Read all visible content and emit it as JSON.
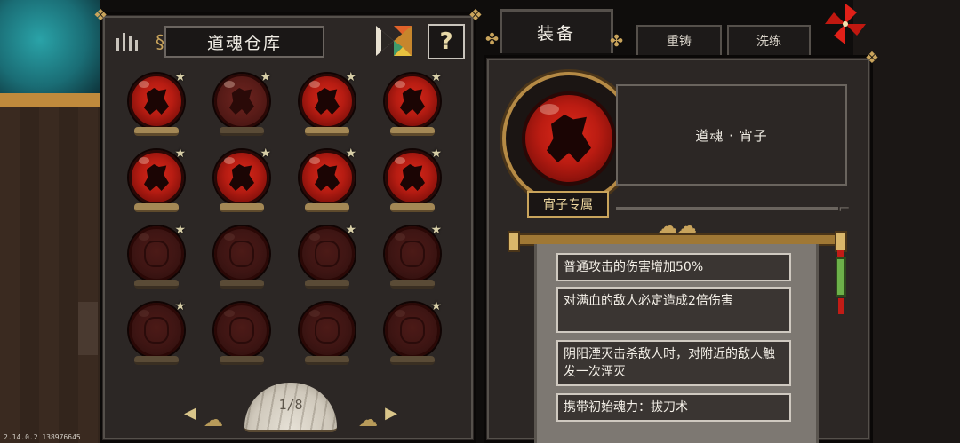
{
  "storage": {
    "title": "道魂仓库",
    "help_label": "?",
    "pager": {
      "current": 1,
      "total": 8,
      "label": "1/8",
      "prev_label": "◀",
      "next_label": "▶"
    },
    "slots": [
      {
        "state": "owned",
        "starred": true
      },
      {
        "state": "dim",
        "starred": true
      },
      {
        "state": "owned",
        "starred": true
      },
      {
        "state": "owned",
        "starred": true
      },
      {
        "state": "owned",
        "starred": true
      },
      {
        "state": "owned",
        "starred": true
      },
      {
        "state": "owned",
        "starred": true
      },
      {
        "state": "owned",
        "starred": true
      },
      {
        "state": "locked",
        "starred": true
      },
      {
        "state": "locked",
        "starred": false
      },
      {
        "state": "locked",
        "starred": true
      },
      {
        "state": "locked",
        "starred": true
      },
      {
        "state": "locked",
        "starred": true
      },
      {
        "state": "locked",
        "starred": false
      },
      {
        "state": "locked",
        "starred": false
      },
      {
        "state": "locked",
        "starred": true
      }
    ]
  },
  "tabs": {
    "equip": "装备",
    "reforge": "重铸",
    "refine": "洗练"
  },
  "detail": {
    "name": "道魂 · 宵子",
    "exclusive_tag": "宵子专属",
    "effects": [
      "普通攻击的伤害增加50%",
      "对满血的敌人必定造成2倍伤害",
      "阴阳湮灭击杀敌人时，对附近的敌人触发一次湮灭",
      "携带初始魂力：拔刀术"
    ]
  },
  "version": "2.14.0.2 138976645",
  "colors": {
    "orb_red": "#c41f14",
    "gold": "#c9a45c",
    "panel": "#2c2725"
  }
}
